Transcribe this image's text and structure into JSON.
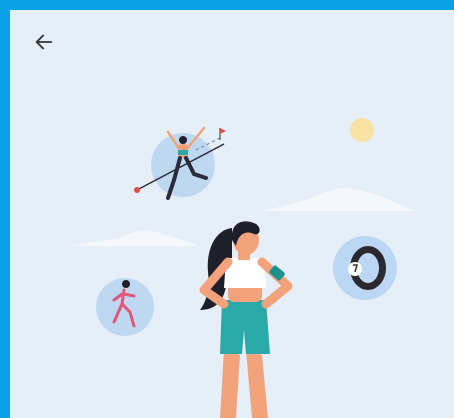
{
  "header": {
    "back_icon": "arrow-left-icon"
  },
  "illustration": {
    "elements": [
      "sun",
      "cloud",
      "cloud",
      "jumping-athlete-bubble",
      "runner-bubble",
      "smart-ring-bubble",
      "woman-standing"
    ]
  },
  "colors": {
    "frame": "#0aa0e6",
    "background": "#e6eff8",
    "accent_teal": "#2aa9a8",
    "skin": "#f2a37b",
    "hair": "#1f1f2b"
  }
}
